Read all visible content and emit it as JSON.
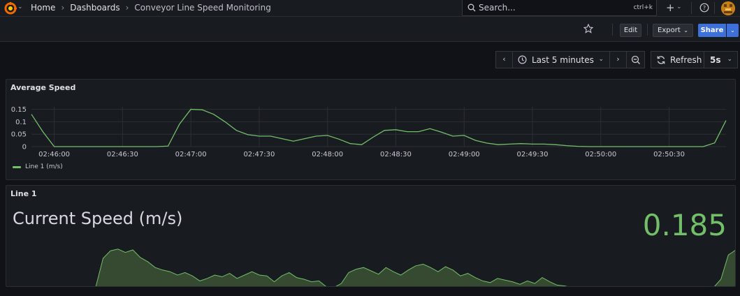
{
  "breadcrumb": {
    "home": "Home",
    "dashboards": "Dashboards",
    "current": "Conveyor Line Speed Monitoring"
  },
  "search": {
    "placeholder": "Search...",
    "shortcut": "ctrl+k"
  },
  "toolbar": {
    "edit_label": "Edit",
    "export_label": "Export",
    "share_label": "Share"
  },
  "timepicker": {
    "range_label": "Last 5 minutes",
    "refresh_label": "Refresh",
    "interval_label": "5s"
  },
  "colors": {
    "accent": "#3d71d9",
    "series": "#73bf69"
  },
  "icons": [
    "grafana-logo-icon",
    "search-icon",
    "plus-icon",
    "help-icon",
    "star-icon",
    "clock-icon",
    "zoom-out-icon",
    "refresh-icon"
  ],
  "panels": {
    "average": {
      "title": "Average Speed",
      "legend": "Line 1 (m/s)"
    },
    "line1": {
      "title": "Line 1",
      "stat_label": "Current Speed (m/s)",
      "stat_value": "0.185"
    }
  },
  "chart_data": [
    {
      "type": "line",
      "title": "Average Speed",
      "xlabel": "",
      "ylabel": "",
      "ylim": [
        0,
        0.16
      ],
      "y_ticks": [
        "0",
        "0.05",
        "0.1",
        "0.15"
      ],
      "x_ticks": [
        "02:46:00",
        "02:46:30",
        "02:47:00",
        "02:47:30",
        "02:48:00",
        "02:48:30",
        "02:49:00",
        "02:49:30",
        "02:50:00",
        "02:50:30"
      ],
      "grid": true,
      "legend_position": "bottom-left",
      "series": [
        {
          "name": "Line 1 (m/s)",
          "color": "#73bf69",
          "x": [
            "02:45:50",
            "02:45:55",
            "02:46:00",
            "02:46:05",
            "02:46:10",
            "02:46:15",
            "02:46:20",
            "02:46:25",
            "02:46:30",
            "02:46:35",
            "02:46:40",
            "02:46:45",
            "02:46:50",
            "02:46:55",
            "02:47:00",
            "02:47:05",
            "02:47:10",
            "02:47:15",
            "02:47:20",
            "02:47:25",
            "02:47:30",
            "02:47:35",
            "02:47:40",
            "02:47:45",
            "02:47:50",
            "02:47:55",
            "02:48:00",
            "02:48:05",
            "02:48:10",
            "02:48:15",
            "02:48:20",
            "02:48:25",
            "02:48:30",
            "02:48:35",
            "02:48:40",
            "02:48:45",
            "02:48:50",
            "02:48:55",
            "02:49:00",
            "02:49:05",
            "02:49:10",
            "02:49:15",
            "02:49:20",
            "02:49:25",
            "02:49:30",
            "02:49:35",
            "02:49:40",
            "02:49:45",
            "02:49:50",
            "02:49:55",
            "02:50:00",
            "02:50:05",
            "02:50:10",
            "02:50:15",
            "02:50:20",
            "02:50:25",
            "02:50:30",
            "02:50:35",
            "02:50:40",
            "02:50:45",
            "02:50:50",
            "02:50:55"
          ],
          "values": [
            0.13,
            0.06,
            0,
            0,
            0,
            0,
            0,
            0,
            0,
            0,
            0,
            0,
            0.002,
            0.09,
            0.15,
            0.148,
            0.13,
            0.1,
            0.065,
            0.048,
            0.042,
            0.042,
            0.032,
            0.022,
            0.032,
            0.042,
            0.045,
            0.03,
            0.012,
            0.008,
            0.038,
            0.065,
            0.068,
            0.06,
            0.06,
            0.072,
            0.058,
            0.042,
            0.045,
            0.025,
            0.014,
            0.008,
            0.01,
            0.012,
            0.01,
            0.01,
            0.008,
            0.004,
            0.001,
            0,
            0,
            0,
            0,
            0,
            0,
            0,
            0,
            0,
            0,
            0,
            0.015,
            0.105
          ]
        }
      ]
    },
    {
      "type": "area",
      "title": "Current Speed (m/s) sparkline",
      "series": [
        {
          "name": "",
          "color": "#73bf69",
          "values": [
            0,
            0,
            0,
            0,
            0,
            0,
            0,
            0,
            0,
            0,
            0,
            0,
            0,
            0.7,
            0.88,
            0.92,
            0.84,
            0.9,
            0.72,
            0.62,
            0.48,
            0.42,
            0.38,
            0.3,
            0.36,
            0.28,
            0.16,
            0.22,
            0.3,
            0.26,
            0.34,
            0.22,
            0.3,
            0.38,
            0.3,
            0.28,
            0.14,
            0.28,
            0.36,
            0.24,
            0.2,
            0.14,
            0.16,
            0.02,
            0,
            0.1,
            0.36,
            0.44,
            0.48,
            0.4,
            0.32,
            0.48,
            0.38,
            0.3,
            0.42,
            0.52,
            0.56,
            0.48,
            0.38,
            0.5,
            0.42,
            0.28,
            0.34,
            0.24,
            0.16,
            0.12,
            0.22,
            0.18,
            0.14,
            0.08,
            0.16,
            0.1,
            0.24,
            0.14,
            0.06,
            0.04,
            0,
            0,
            0,
            0,
            0,
            0,
            0,
            0,
            0,
            0,
            0,
            0,
            0,
            0,
            0,
            0,
            0,
            0,
            0,
            0,
            0.2,
            0.78,
            0.9
          ]
        }
      ]
    }
  ]
}
